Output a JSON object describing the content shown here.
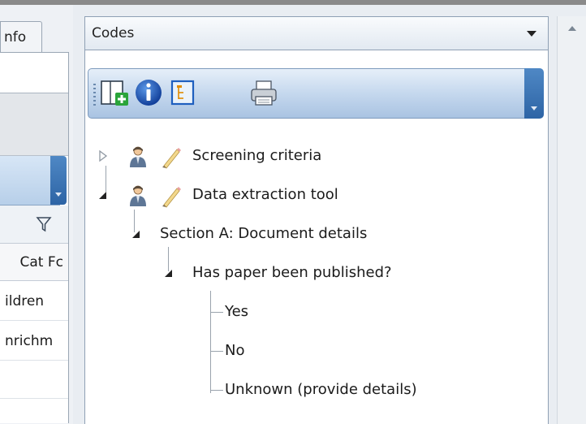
{
  "left_panel": {
    "tab_label": "nfo",
    "column_header": "Cat Fc",
    "rows": [
      "ildren",
      "nrichm",
      ""
    ]
  },
  "codes_panel": {
    "selector_label": "Codes",
    "toolbar_icons": [
      "add-code-set-icon",
      "info-icon",
      "tree-view-icon",
      "print-icon"
    ],
    "tree": {
      "items": [
        {
          "label": "Screening criteria",
          "expanded": false
        },
        {
          "label": "Data extraction tool",
          "expanded": true
        },
        {
          "label": "Section A: Document details",
          "expanded": true
        },
        {
          "label": "Has paper been published?",
          "expanded": true
        },
        {
          "label": "Yes"
        },
        {
          "label": "No"
        },
        {
          "label": "Unknown (provide details)"
        }
      ]
    }
  },
  "colors": {
    "toolbar_blue": "#c5d8ee",
    "handle_blue": "#2d64a5",
    "info_blue": "#1f5fbf"
  }
}
